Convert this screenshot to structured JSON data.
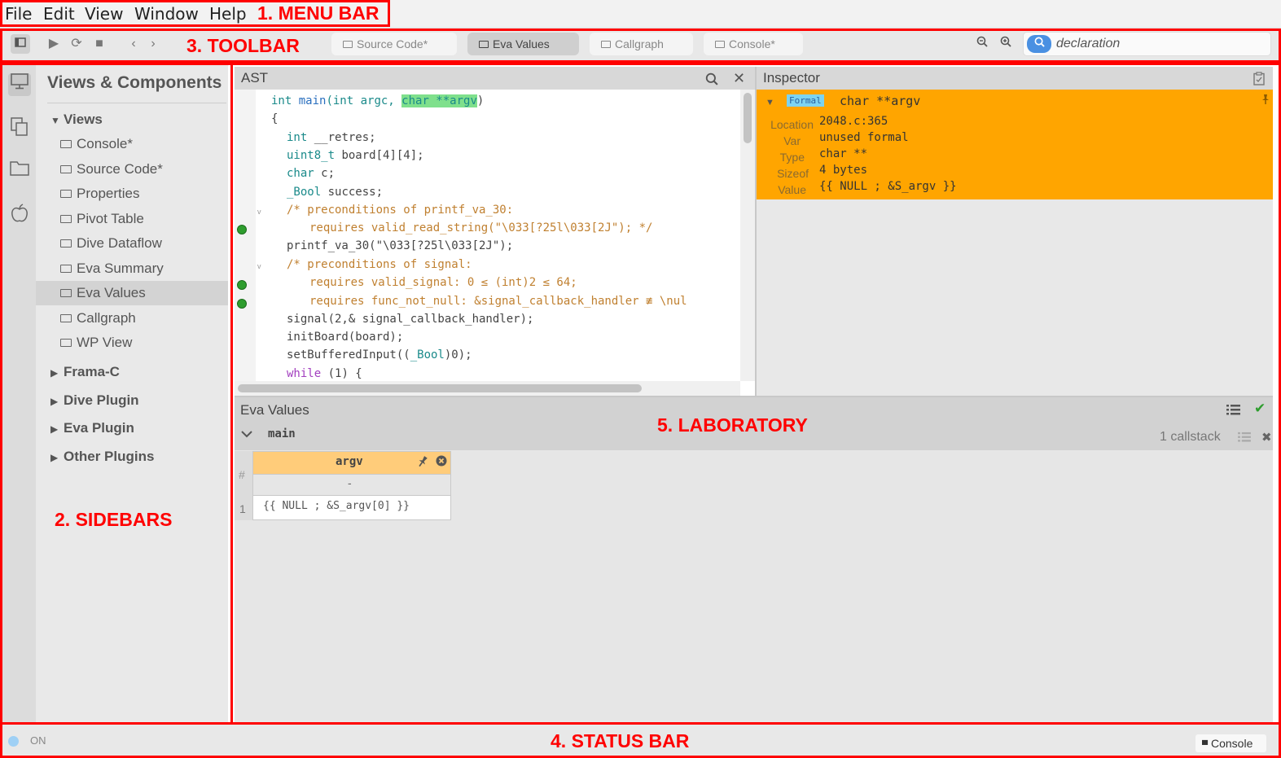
{
  "menu": {
    "items": [
      "File",
      "Edit",
      "View",
      "Window",
      "Help"
    ]
  },
  "annotations": {
    "menu_bar": "1. MENU BAR",
    "sidebars": "2. SIDEBARS",
    "toolbar": "3. TOOLBAR",
    "status_bar": "4. STATUS BAR",
    "laboratory": "5. LABORATORY"
  },
  "toolbar": {
    "tabs": [
      {
        "label": "Source Code*",
        "active": false
      },
      {
        "label": "Eva Values",
        "active": true
      },
      {
        "label": "Callgraph",
        "active": false
      },
      {
        "label": "Console*",
        "active": false
      }
    ],
    "search": {
      "value": "declaration"
    },
    "icons": [
      "sidebar-toggle-icon",
      "play-icon",
      "reload-icon",
      "stop-icon",
      "back-icon",
      "forward-icon",
      "zoom-out-icon",
      "zoom-in-icon",
      "search-icon"
    ]
  },
  "iconbar": {
    "icons": [
      "monitor-icon",
      "components-icon",
      "folder-icon",
      "apple-icon"
    ]
  },
  "sidebar": {
    "title": "Views & Components",
    "groups": {
      "views": "Views",
      "framac": "Frama-C",
      "dive": "Dive Plugin",
      "eva": "Eva Plugin",
      "other": "Other Plugins"
    },
    "items": [
      "Console*",
      "Source Code*",
      "Properties",
      "Pivot Table",
      "Dive Dataflow",
      "Eva Summary",
      "Eva Values",
      "Callgraph",
      "WP View"
    ],
    "selected": "Eva Values"
  },
  "ast": {
    "title": "AST",
    "lines": {
      "l1": {
        "a": "int ",
        "b": "main",
        "c": "(int argc, ",
        "d": "char **argv",
        "e": ")"
      },
      "l2": "{",
      "l3": {
        "a": "int",
        "b": " __retres;"
      },
      "l4": {
        "a": "uint8_t",
        "b": " board[4][4];"
      },
      "l5": {
        "a": "char",
        "b": " c;"
      },
      "l6": {
        "a": "_Bool",
        "b": " success;"
      },
      "l7": "/* preconditions of printf_va_30:",
      "l8": "requires valid_read_string(\"\\033[?25l\\033[2J\"); */",
      "l9": "printf_va_30(\"\\033[?25l\\033[2J\");",
      "l10": "/* preconditions of signal:",
      "l11": "requires valid_signal: 0 ≤ (int)2 ≤ 64;",
      "l12": "requires func_not_null: &signal_callback_handler ≢ \\nul",
      "l13": "signal(2,& signal_callback_handler);",
      "l14": "initBoard(board);",
      "l15": {
        "a": "setBufferedInput((",
        "b": "_Bool",
        "c": ")0);"
      },
      "l16": {
        "a": "while",
        "b": " (1) {"
      }
    }
  },
  "inspector": {
    "title": "Inspector",
    "badge": "Formal",
    "declaration": "char **argv",
    "labels": {
      "location": "Location",
      "var": "Var",
      "type": "Type",
      "sizeof": "Sizeof",
      "value": "Value"
    },
    "values": {
      "location": "2048.c:365",
      "var": "unused formal",
      "type": "char **",
      "sizeof": "4 bytes",
      "value": "{{ NULL ; &S_argv }}"
    }
  },
  "laboratory": {
    "title": "Eva Values",
    "function": "main",
    "callstack": "1 callstack",
    "table": {
      "column": "argv",
      "hash": "#",
      "row_header": "-",
      "row_num": "1",
      "cell": "{{ NULL ; &S_argv[0] }}"
    }
  },
  "statusbar": {
    "status": "ON",
    "console": "Console"
  },
  "colors": {
    "annotation": "#ff0000",
    "inspector_bg": "#ffa500",
    "accent": "#4a90e2",
    "highlight": "#7fe08c"
  }
}
